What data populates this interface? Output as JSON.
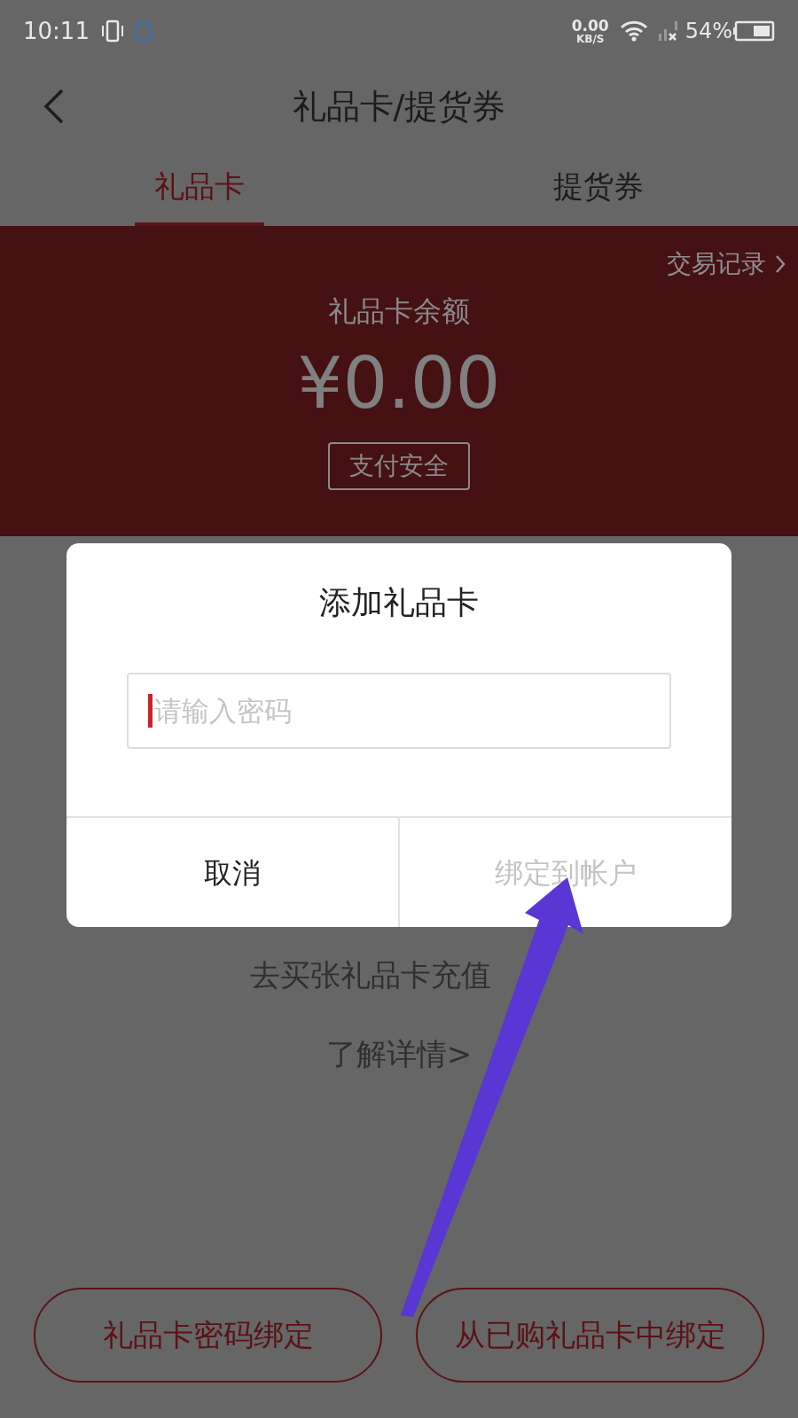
{
  "status_bar": {
    "time": "10:11",
    "net_speed": "0.00",
    "net_unit": "KB/S",
    "battery": "54%"
  },
  "nav": {
    "title": "礼品卡/提货券"
  },
  "tabs": [
    {
      "label": "礼品卡",
      "selected": true
    },
    {
      "label": "提货券",
      "selected": false
    }
  ],
  "balance": {
    "records_link": "交易记录",
    "title": "礼品卡余额",
    "amount": "¥0.00",
    "security_button": "支付安全"
  },
  "empty": {
    "message": "去买张礼品卡充值",
    "link": "了解详情>"
  },
  "bottom_buttons": [
    "礼品卡密码绑定",
    "从已购礼品卡中绑定"
  ],
  "dialog": {
    "title": "添加礼品卡",
    "input": {
      "placeholder": "请输入密码"
    },
    "buttons": [
      {
        "label": "取消",
        "disabled": false
      },
      {
        "label": "绑定到帐户",
        "disabled": true
      }
    ]
  }
}
